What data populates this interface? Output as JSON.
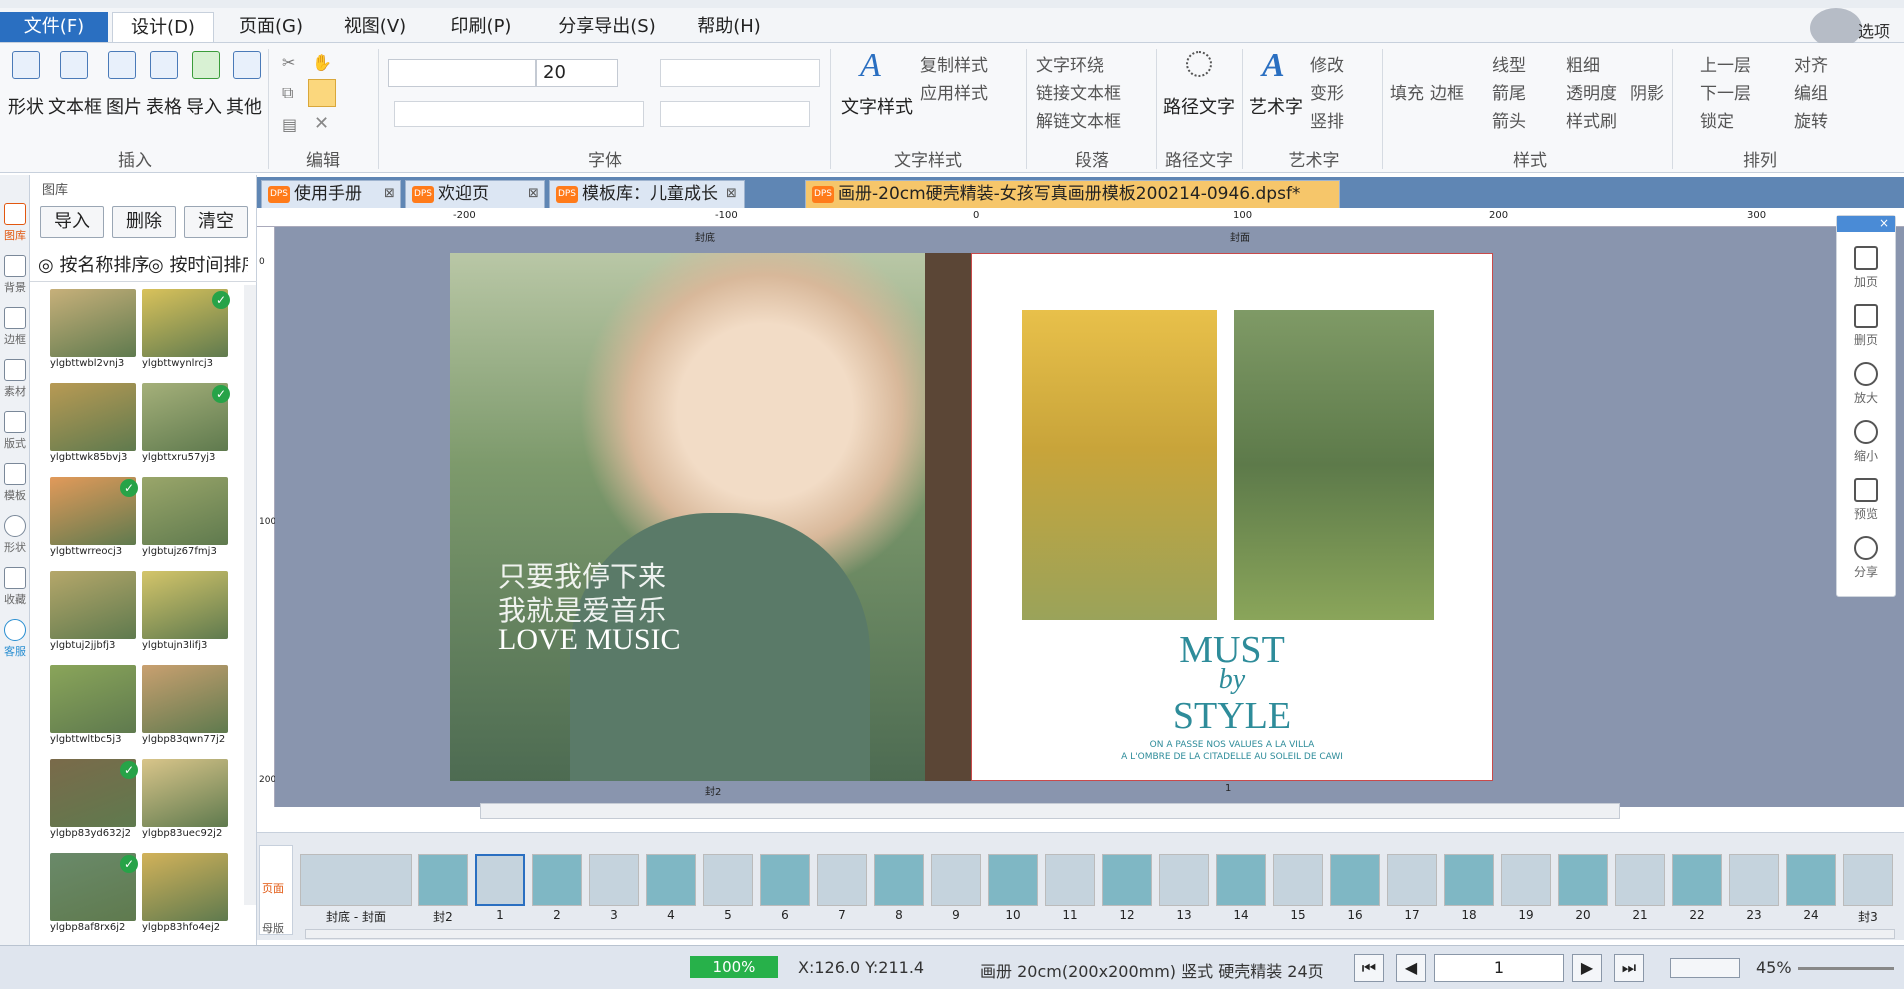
{
  "menu": {
    "items": [
      "文件(F)",
      "设计(D)",
      "页面(G)",
      "视图(V)",
      "印刷(P)",
      "分享导出(S)",
      "帮助(H)"
    ],
    "top_right": "选项"
  },
  "ribbon": {
    "insert": {
      "buttons": [
        "形状",
        "文本框",
        "图片",
        "表格",
        "导入",
        "其他"
      ],
      "group": "插入"
    },
    "edit": {
      "group": "编辑"
    },
    "font": {
      "size": "20",
      "group": "字体"
    },
    "textstyle": {
      "main": "文字样式",
      "copy": "复制样式",
      "apply": "应用样式",
      "group": "文字样式"
    },
    "paragraph": {
      "wrap": "文字环绕",
      "link": "链接文本框",
      "unlink": "解链文本框",
      "group": "段落"
    },
    "pathtext": {
      "main": "路径文字",
      "group": "路径文字"
    },
    "arttext": {
      "main": "艺术字",
      "modify": "修改",
      "deform": "变形",
      "vertical": "竖排",
      "group": "艺术字"
    },
    "style": {
      "fill": "填充",
      "border": "边框",
      "line": "线型",
      "thick": "粗细",
      "tail": "箭尾",
      "transp": "透明度",
      "head": "箭头",
      "brush": "样式刷",
      "shadow": "阴影",
      "group": "样式"
    },
    "arrange": {
      "up": "上一层",
      "align": "对齐",
      "down": "下一层",
      "group_btn": "编组",
      "lock": "锁定",
      "rotate": "旋转",
      "group": "排列"
    }
  },
  "leftstrip": [
    "图库",
    "背景",
    "边框",
    "素材",
    "版式",
    "模板",
    "形状",
    "收藏",
    "客服"
  ],
  "leftpanel": {
    "title": "图库",
    "buttons": [
      "导入",
      "删除",
      "清空"
    ],
    "sort": [
      "按名称排序",
      "按时间排序"
    ],
    "thumbs": [
      {
        "name": "ylgbttwbl2vnj3",
        "check": false
      },
      {
        "name": "ylgbttwynlrcj3",
        "check": true
      },
      {
        "name": "ylgbttwk85bvj3",
        "check": false
      },
      {
        "name": "ylgbttxru57yj3",
        "check": true
      },
      {
        "name": "ylgbttwrreocj3",
        "check": true
      },
      {
        "name": "ylgbtujz67fmj3",
        "check": false
      },
      {
        "name": "ylgbtuj2jjbfj3",
        "check": false
      },
      {
        "name": "ylgbtujn3lifj3",
        "check": false
      },
      {
        "name": "ylgbttwltbc5j3",
        "check": false
      },
      {
        "name": "ylgbp83qwn77j2",
        "check": false
      },
      {
        "name": "ylgbp83yd632j2",
        "check": true
      },
      {
        "name": "ylgbp83uec92j2",
        "check": false
      },
      {
        "name": "ylgbp8af8rx6j2",
        "check": true
      },
      {
        "name": "ylgbp83hfo4ej2",
        "check": false
      }
    ]
  },
  "tabs": [
    {
      "badge": "DPS",
      "label": "使用手册"
    },
    {
      "badge": "DPS",
      "label": "欢迎页"
    },
    {
      "badge": "DPS",
      "label": "模板库：儿童成长"
    },
    {
      "badge": "DPS",
      "label": "画册-20cm硬壳精装-女孩写真画册模板200214-0946.dpsf*"
    }
  ],
  "ruler": {
    "h": [
      "-200",
      "-100",
      "0",
      "100",
      "200",
      "300"
    ],
    "v": [
      "0",
      "100",
      "200"
    ]
  },
  "page": {
    "label_left": "封底",
    "label_right": "封面",
    "label_bottom_left": "封2",
    "label_bottom_right": "1",
    "left_text": {
      "line1": "只要我停下来",
      "line2": "我就是爱音乐",
      "line3": "LOVE MUSIC"
    },
    "right_text": {
      "must": "MUST",
      "by": "by",
      "style": "STYLE",
      "sub1": "ON A PASSE NOS VALUES A LA VILLA",
      "sub2": "A L'OMBRE DE LA CITADELLE AU SOLEIL DE CAWI"
    }
  },
  "rightbar": [
    "加页",
    "删页",
    "放大",
    "缩小",
    "预览",
    "分享"
  ],
  "bottomtabs": [
    "页面",
    "母版"
  ],
  "pages": [
    "封底 - 封面",
    "封2",
    "1",
    "2",
    "3",
    "4",
    "5",
    "6",
    "7",
    "8",
    "9",
    "10",
    "11",
    "12",
    "13",
    "14",
    "15",
    "16",
    "17",
    "18",
    "19",
    "20",
    "21",
    "22",
    "23",
    "24",
    "封3"
  ],
  "status": {
    "progress": "100%",
    "coords": "X:126.0  Y:211.4",
    "info": "画册 20cm(200x200mm) 竖式 硬壳精装 24页",
    "page": "1",
    "zoom": "45%"
  },
  "colors": {
    "accent": "#2a6fc1",
    "canvas": "#8995ae",
    "activetab": "#f6c66a",
    "teal": "#2e8c9a"
  }
}
